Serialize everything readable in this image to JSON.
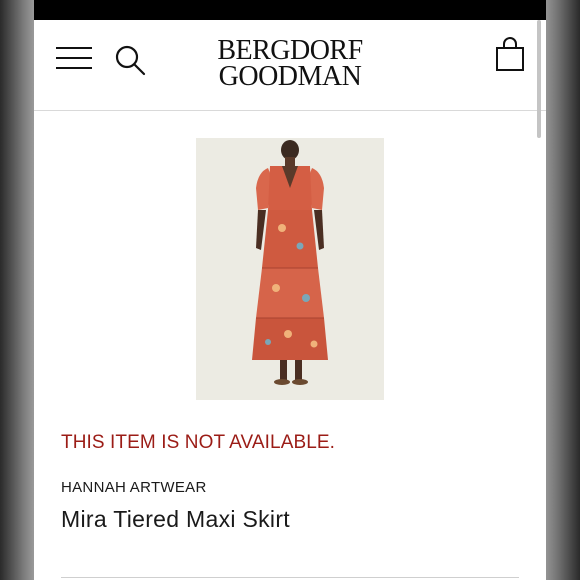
{
  "header": {
    "logo_line1": "BERGDORF",
    "logo_line2": "GOODMAN",
    "menu_icon": "hamburger-menu-icon",
    "search_icon": "search-icon",
    "bag_icon": "shopping-bag-icon"
  },
  "product": {
    "image_icon": "product-photo",
    "availability": "THIS ITEM IS NOT AVAILABLE.",
    "availability_color": "#9b1c16",
    "brand": "HANNAH ARTWEAR",
    "name": "Mira Tiered Maxi Skirt"
  }
}
